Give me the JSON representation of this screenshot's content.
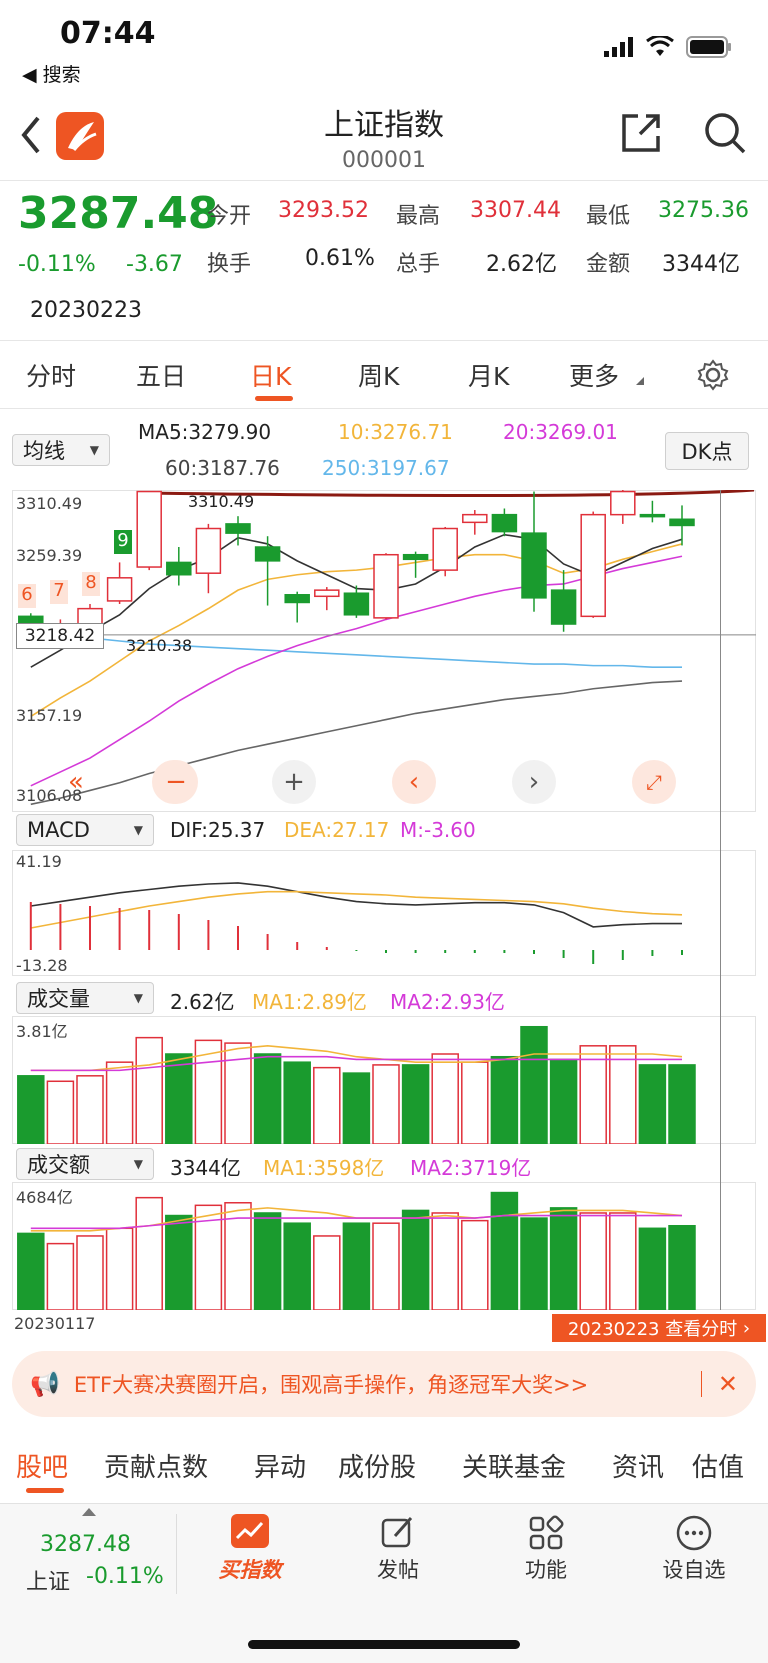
{
  "status_bar": {
    "time": "07:44",
    "back_label": "◀ 搜索"
  },
  "header": {
    "title": "上证指数",
    "code": "000001"
  },
  "quote": {
    "price": "3287.48",
    "change_pct": "-0.11%",
    "change_abs": "-3.67",
    "date": "20230223",
    "open_label": "今开",
    "open": "3293.52",
    "high_label": "最高",
    "high": "3307.44",
    "low_label": "最低",
    "low": "3275.36",
    "turnover_label": "换手",
    "turnover": "0.61%",
    "volume_label": "总手",
    "volume": "2.62亿",
    "amount_label": "金额",
    "amount": "3344亿"
  },
  "tabs": [
    "分时",
    "五日",
    "日K",
    "周K",
    "月K",
    "更多"
  ],
  "active_tab": "日K",
  "indicator_bar": {
    "selector": "均线",
    "ma5": "MA5:3279.90",
    "ma10": "10:3276.71",
    "ma20": "20:3269.01",
    "ma60": "60:3187.76",
    "ma250": "250:3197.67",
    "dk_button": "DK点"
  },
  "kline": {
    "y_ticks": [
      "3310.49",
      "3259.39",
      "3157.19",
      "3106.08"
    ],
    "crosshair_label": "3218.42",
    "max_marker": "3310.49",
    "min_marker": "3210.38",
    "signal_marks": [
      "6",
      "7",
      "8",
      "9"
    ],
    "candles": [
      {
        "o": 3230,
        "c": 3222,
        "h": 3232,
        "l": 3218,
        "up": false
      },
      {
        "o": 3218,
        "c": 3225,
        "h": 3228,
        "l": 3213,
        "up": true
      },
      {
        "o": 3222,
        "c": 3235,
        "h": 3238,
        "l": 3218,
        "up": true
      },
      {
        "o": 3240,
        "c": 3255,
        "h": 3265,
        "l": 3238,
        "up": true
      },
      {
        "o": 3262,
        "c": 3311,
        "h": 3311,
        "l": 3260,
        "up": true
      },
      {
        "o": 3265,
        "c": 3257,
        "h": 3275,
        "l": 3250,
        "up": false
      },
      {
        "o": 3258,
        "c": 3287,
        "h": 3290,
        "l": 3245,
        "up": true
      },
      {
        "o": 3290,
        "c": 3284,
        "h": 3295,
        "l": 3276,
        "up": false
      },
      {
        "o": 3275,
        "c": 3266,
        "h": 3282,
        "l": 3237,
        "up": false
      },
      {
        "o": 3244,
        "c": 3239,
        "h": 3246,
        "l": 3226,
        "up": false
      },
      {
        "o": 3243,
        "c": 3247,
        "h": 3249,
        "l": 3234,
        "up": true
      },
      {
        "o": 3245,
        "c": 3231,
        "h": 3250,
        "l": 3229,
        "up": false
      },
      {
        "o": 3229,
        "c": 3270,
        "h": 3271,
        "l": 3228,
        "up": true
      },
      {
        "o": 3267,
        "c": 3270,
        "h": 3272,
        "l": 3255,
        "up": false
      },
      {
        "o": 3260,
        "c": 3287,
        "h": 3288,
        "l": 3256,
        "up": true
      },
      {
        "o": 3291,
        "c": 3296,
        "h": 3299,
        "l": 3283,
        "up": true
      },
      {
        "o": 3296,
        "c": 3285,
        "h": 3300,
        "l": 3282,
        "up": false
      },
      {
        "o": 3284,
        "c": 3242,
        "h": 3311,
        "l": 3233,
        "up": false
      },
      {
        "o": 3247,
        "c": 3225,
        "h": 3260,
        "l": 3220,
        "up": false
      },
      {
        "o": 3230,
        "c": 3296,
        "h": 3298,
        "l": 3229,
        "up": true
      },
      {
        "o": 3296,
        "c": 3311,
        "h": 3312,
        "l": 3290,
        "up": true
      },
      {
        "o": 3296,
        "c": 3296,
        "h": 3305,
        "l": 3291,
        "up": false
      },
      {
        "o": 3293,
        "c": 3289,
        "h": 3302,
        "l": 3276,
        "up": false
      }
    ]
  },
  "macd": {
    "selector": "MACD",
    "dif": "DIF:25.37",
    "dea": "DEA:27.17",
    "m": "M:-3.60",
    "y_ticks": [
      "41.19",
      "-13.28"
    ]
  },
  "volume": {
    "selector": "成交量",
    "current": "2.62亿",
    "ma1": "MA1:2.89亿",
    "ma2": "MA2:2.93亿",
    "y_tick": "3.81亿",
    "bars": [
      2.5,
      2.3,
      2.5,
      3.0,
      3.9,
      3.3,
      3.8,
      3.7,
      3.3,
      3.0,
      2.8,
      2.6,
      2.9,
      2.9,
      3.3,
      3.0,
      3.2,
      4.3,
      3.1,
      3.6,
      3.6,
      2.9,
      2.9
    ],
    "colors_up": [
      false,
      true,
      true,
      true,
      true,
      false,
      true,
      true,
      false,
      false,
      true,
      false,
      true,
      false,
      true,
      true,
      false,
      false,
      false,
      true,
      true,
      false,
      false
    ]
  },
  "amount": {
    "selector": "成交额",
    "current": "3344亿",
    "ma1": "MA1:3598亿",
    "ma2": "MA2:3719亿",
    "y_tick": "4684亿",
    "bars": [
      3.0,
      2.6,
      2.9,
      3.2,
      4.4,
      3.7,
      4.1,
      4.2,
      3.8,
      3.4,
      2.9,
      3.4,
      3.4,
      3.9,
      3.8,
      3.5,
      4.6,
      3.6,
      4.0,
      3.8,
      3.8,
      3.2,
      3.3
    ],
    "start_date": "20230117",
    "end_chip": "20230223 查看分时"
  },
  "banner": {
    "text": "ETF大赛决赛圈开启，围观高手操作，角逐冠军大奖>>"
  },
  "subtabs": [
    "股吧",
    "贡献点数",
    "异动",
    "成份股",
    "关联基金",
    "资讯",
    "估值"
  ],
  "bottom_bar": {
    "mini_price": "3287.48",
    "mini_name": "上证",
    "mini_change": "-0.11%",
    "items": [
      "买指数",
      "发帖",
      "功能",
      "设自选"
    ]
  },
  "colors": {
    "up": "#e0303a",
    "down": "#1a9b2e",
    "accent": "#ee5523"
  }
}
